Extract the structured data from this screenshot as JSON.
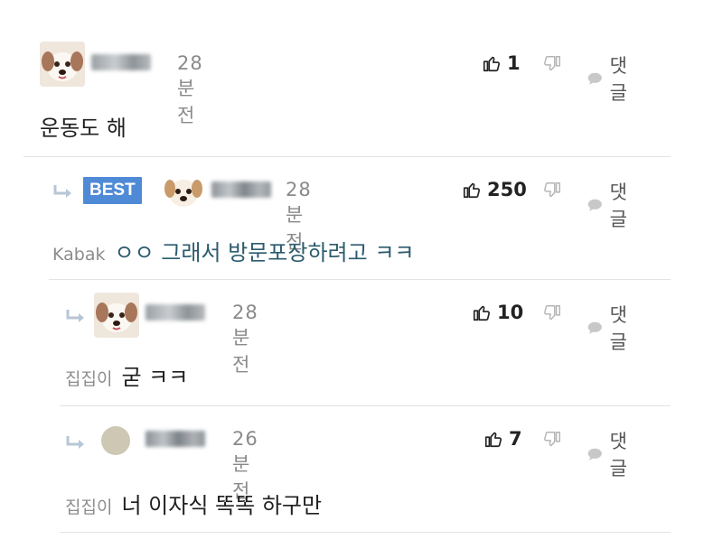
{
  "comments": [
    {
      "time": "28 분 전",
      "likes": "1",
      "reply_label": "댓글",
      "text": "운동도 해",
      "mention": ""
    },
    {
      "badge": "BEST",
      "time": "28 분 전",
      "likes": "250",
      "reply_label": "댓글",
      "mention": "Kabak",
      "text": "ㅇㅇ 그래서 방문포장하려고 ㅋㅋ"
    },
    {
      "time": "28 분 전",
      "likes": "10",
      "reply_label": "댓글",
      "mention": "집집이",
      "text": "굳 ㅋㅋ"
    },
    {
      "time": "26 분 전",
      "likes": "7",
      "reply_label": "댓글",
      "mention": "집집이",
      "text": "너 이자식 똑똑 하구만"
    }
  ],
  "icons": {
    "like": "thumbs-up-icon",
    "dislike": "thumbs-down-icon",
    "reply": "speech-bubble-icon",
    "reply_arrow": "reply-arrow-icon"
  },
  "colors": {
    "best_badge": "#4f8ad6",
    "reply_text": "#2c5b6e",
    "muted": "#8a8a8a",
    "divider": "#e3e3e3"
  }
}
